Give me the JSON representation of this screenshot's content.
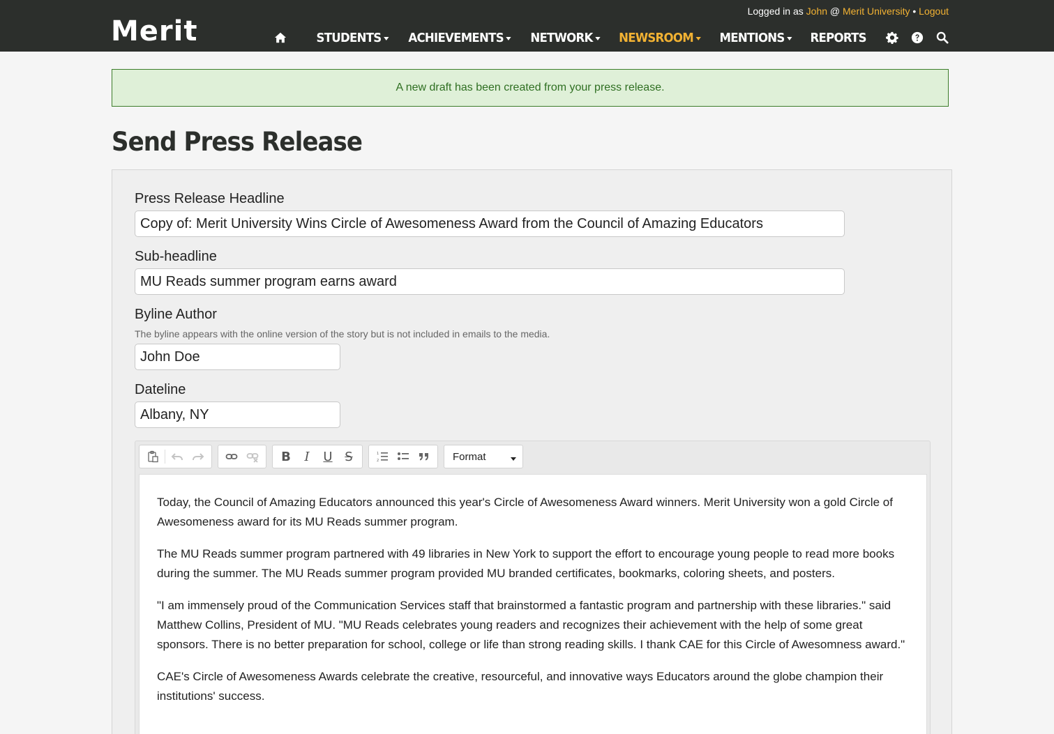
{
  "header": {
    "logo": "Merit",
    "login": {
      "prefix": "Logged in as",
      "user": "John",
      "at": "@",
      "org": "Merit University",
      "separator": "•",
      "logout": "Logout"
    },
    "nav": [
      {
        "label": "STUDENTS",
        "dropdown": true
      },
      {
        "label": "ACHIEVEMENTS",
        "dropdown": true
      },
      {
        "label": "NETWORK",
        "dropdown": true
      },
      {
        "label": "NEWSROOM",
        "dropdown": true,
        "active": true
      },
      {
        "label": "MENTIONS",
        "dropdown": true
      },
      {
        "label": "REPORTS",
        "dropdown": false
      }
    ],
    "icons": [
      "home-icon",
      "gear-icon",
      "help-icon",
      "search-icon"
    ]
  },
  "alert": {
    "message": "A new draft has been created from your press release."
  },
  "page": {
    "title": "Send Press Release"
  },
  "form": {
    "headline": {
      "label": "Press Release Headline",
      "value": "Copy of: Merit University Wins Circle of Awesomeness Award from the Council of Amazing Educators"
    },
    "subheadline": {
      "label": "Sub-headline",
      "value": "MU Reads summer program earns award"
    },
    "byline": {
      "label": "Byline Author",
      "help": "The byline appears with the online version of the story but is not included in emails to the media.",
      "value": "John Doe"
    },
    "dateline": {
      "label": "Dateline",
      "value": "Albany, NY"
    }
  },
  "editor": {
    "format_label": "Format",
    "toolbar_icons": [
      "paste-icon",
      "undo-icon",
      "redo-icon",
      "link-icon",
      "unlink-icon",
      "bold-icon",
      "italic-icon",
      "underline-icon",
      "strikethrough-icon",
      "numbered-list-icon",
      "bulleted-list-icon",
      "blockquote-icon"
    ],
    "paragraphs": [
      "Today, the Council of Amazing Educators announced this year's Circle of Awesomeness Award winners. Merit University won a gold Circle of Awesomeness award for its MU Reads summer program.",
      "The MU Reads summer program partnered with 49 libraries in New York to support the effort to encourage young people to read more books during the summer. The MU Reads summer program provided MU branded certificates, bookmarks, coloring sheets, and posters.",
      "\"I am immensely proud of the Communication Services staff that brainstormed a fantastic program and partnership with these libraries.\" said Matthew Collins, President of MU. \"MU Reads celebrates young readers and recognizes their achievement with the help of some great sponsors. There is no better preparation for school, college or life than strong reading skills. I thank CAE for this Circle of Awesomness award.\"",
      "CAE's Circle of Awesomeness Awards celebrate the creative, resourceful, and innovative ways Educators around the globe champion their institutions' success."
    ]
  },
  "colors": {
    "header_bg": "#2c2f2c",
    "accent": "#f2b233",
    "alert_bg": "#dff0d8",
    "alert_text": "#2f6f22"
  }
}
